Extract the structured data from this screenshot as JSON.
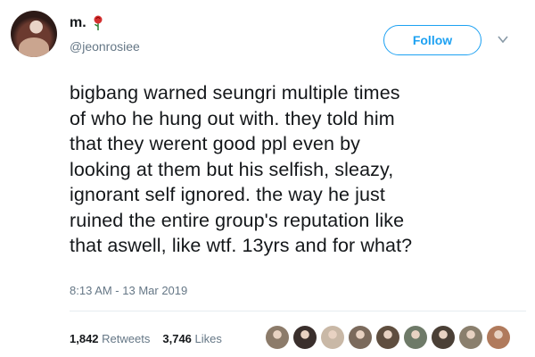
{
  "user": {
    "display_name": "m.",
    "handle": "@jeonrosiee"
  },
  "follow_label": "Follow",
  "tweet": {
    "lines": [
      "bigbang warned seungri multiple times",
      "of who he hung out with. they told him",
      "that they werent good ppl even by",
      "looking at them but his selfish, sleazy,",
      "ignorant self ignored. the way he just",
      "ruined the entire group's reputation like",
      "that aswell, like wtf. 13yrs and for what?"
    ],
    "timestamp": "8:13 AM - 13 Mar 2019"
  },
  "stats": {
    "retweets_count": "1,842",
    "retweets_label": "Retweets",
    "likes_count": "3,746",
    "likes_label": "Likes"
  },
  "colors": {
    "accent": "#1da1f2",
    "secondary_text": "#657786",
    "divider": "#e6ecf0"
  },
  "liker_avatars": [
    {
      "color": "#8c7b6a"
    },
    {
      "color": "#3a2f2c"
    },
    {
      "color": "#c9b8a6"
    },
    {
      "color": "#7b6a5c"
    },
    {
      "color": "#5f4e3f"
    },
    {
      "color": "#6e7a68"
    },
    {
      "color": "#4a3f35"
    },
    {
      "color": "#8a7f6d"
    },
    {
      "color": "#b07a5c"
    }
  ]
}
